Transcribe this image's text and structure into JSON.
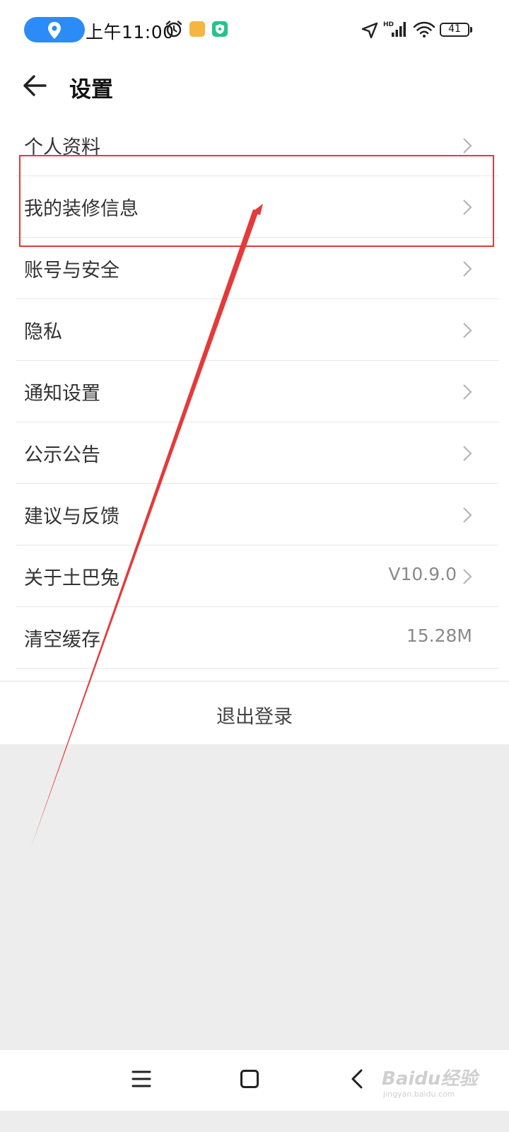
{
  "status_bar": {
    "time": "上午11:00",
    "battery": "41",
    "network_label": "HD"
  },
  "header": {
    "title": "设置"
  },
  "settings": [
    {
      "label": "个人资料",
      "value": "",
      "chevron": true
    },
    {
      "label": "我的装修信息",
      "value": "",
      "chevron": true
    },
    {
      "label": "账号与安全",
      "value": "",
      "chevron": true
    },
    {
      "label": "隐私",
      "value": "",
      "chevron": true
    },
    {
      "label": "通知设置",
      "value": "",
      "chevron": true
    },
    {
      "label": "公示公告",
      "value": "",
      "chevron": true
    },
    {
      "label": "建议与反馈",
      "value": "",
      "chevron": true
    },
    {
      "label": "关于土巴兔",
      "value": "V10.9.0",
      "chevron": true
    },
    {
      "label": "清空缓存",
      "value": "15.28M",
      "chevron": false
    }
  ],
  "logout": {
    "label": "退出登录"
  },
  "annotation": {
    "highlight_color": "#e43a3a",
    "highlighted_item": "我的装修信息"
  },
  "watermark": {
    "brand": "Baidu经验",
    "site": "jingyan.baidu.com"
  },
  "colors": {
    "location_pill": "#2b8cf7",
    "divider": "#e8e8e8",
    "page_background": "#ededed"
  }
}
